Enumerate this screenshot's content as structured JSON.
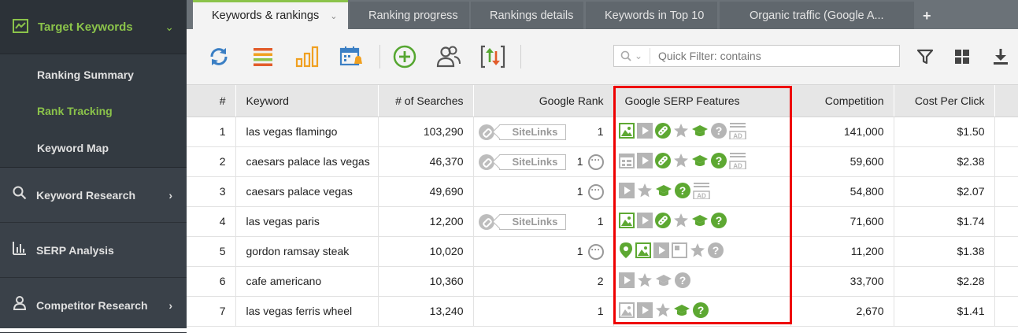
{
  "sidebar": {
    "active": {
      "label": "Target Keywords",
      "icon": "chart-icon"
    },
    "subitems": [
      {
        "label": "Ranking Summary",
        "active": false
      },
      {
        "label": "Rank Tracking",
        "active": true
      },
      {
        "label": "Keyword Map",
        "active": false
      }
    ],
    "items": [
      {
        "label": "Keyword Research",
        "icon": "search-icon"
      },
      {
        "label": "SERP Analysis",
        "icon": "bar-chart-icon"
      },
      {
        "label": "Competitor Research",
        "icon": "user-icon"
      }
    ]
  },
  "tabs": [
    {
      "label": "Keywords & rankings"
    },
    {
      "label": "Ranking progress"
    },
    {
      "label": "Rankings details"
    },
    {
      "label": "Keywords in Top 10"
    },
    {
      "label": "Organic traffic (Google A..."
    }
  ],
  "tab_add": "+",
  "quick_filter": {
    "placeholder": "Quick Filter: contains",
    "value": ""
  },
  "table": {
    "headers": {
      "num": "#",
      "keyword": "Keyword",
      "searches": "# of Searches",
      "rank": "Google Rank",
      "serp": "Google SERP Features",
      "competition": "Competition",
      "cpc": "Cost Per Click"
    },
    "sitelinks_label": "SiteLinks",
    "rows": [
      {
        "num": "1",
        "keyword": "las vegas flamingo",
        "searches": "103,290",
        "sitelinks": true,
        "rank": "1",
        "more": false,
        "features": [
          "image-g",
          "video",
          "link-g",
          "star",
          "grad-g",
          "question",
          "ad-top"
        ],
        "competition": "141,000",
        "cpc": "$1.50"
      },
      {
        "num": "2",
        "keyword": "caesars palace las vegas",
        "searches": "46,370",
        "sitelinks": true,
        "rank": "1",
        "more": true,
        "features": [
          "calendar",
          "video",
          "link-g",
          "star",
          "grad-g",
          "question-g",
          "ad-top"
        ],
        "competition": "59,600",
        "cpc": "$2.38"
      },
      {
        "num": "3",
        "keyword": "caesars palace vegas",
        "searches": "49,690",
        "sitelinks": false,
        "rank": "1",
        "more": true,
        "features": [
          "video",
          "star",
          "grad-g",
          "question-g",
          "ad-top"
        ],
        "competition": "54,800",
        "cpc": "$2.07"
      },
      {
        "num": "4",
        "keyword": "las vegas paris",
        "searches": "12,200",
        "sitelinks": true,
        "rank": "1",
        "more": false,
        "features": [
          "image-g",
          "video",
          "link-g",
          "star",
          "grad-g",
          "question-g"
        ],
        "competition": "71,600",
        "cpc": "$1.74"
      },
      {
        "num": "5",
        "keyword": "gordon ramsay steak",
        "searches": "10,020",
        "sitelinks": false,
        "rank": "1",
        "more": true,
        "features": [
          "pin-g",
          "image-g",
          "video",
          "panel",
          "star",
          "question"
        ],
        "competition": "11,200",
        "cpc": "$1.38"
      },
      {
        "num": "6",
        "keyword": "cafe americano",
        "searches": "10,360",
        "sitelinks": false,
        "rank": "2",
        "more": false,
        "features": [
          "video",
          "star",
          "grad",
          "question"
        ],
        "competition": "33,700",
        "cpc": "$2.28"
      },
      {
        "num": "7",
        "keyword": "las vegas ferris wheel",
        "searches": "13,240",
        "sitelinks": false,
        "rank": "1",
        "more": false,
        "features": [
          "image",
          "video",
          "star",
          "grad-g",
          "question-g"
        ],
        "competition": "2,670",
        "cpc": "$1.41"
      }
    ]
  }
}
